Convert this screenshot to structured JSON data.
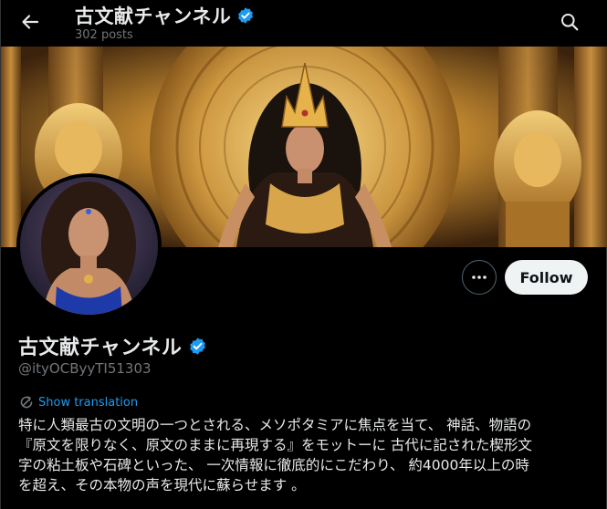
{
  "header": {
    "title": "古文献チャンネル",
    "posts": "302 posts",
    "back_icon": "arrow-left-icon",
    "search_icon": "search-icon"
  },
  "profile": {
    "display_name": "古文献チャンネル",
    "handle": "@ityOCByyTI51303",
    "verified": true,
    "verified_color": "#1d9bf0",
    "show_translation": "Show translation",
    "bio_lines": [
      "特に人類最古の文明の一つとされる、メソポタミアに焦点を当て、 神話、物語の",
      "『原文を限りなく、原文のままに再現する』をモットーに 古代に記された楔形文",
      "字の粘土板や石碑といった、 一次情報に徹底的にこだわり、 約4000年以上の時",
      "を超え、その本物の声を現代に蘇らせます 。"
    ]
  },
  "actions": {
    "follow_label": "Follow",
    "more_icon": "more-dots-icon"
  },
  "colors": {
    "accent": "#1d9bf0",
    "background": "#000000",
    "text_primary": "#e7e9ea",
    "text_secondary": "#71767b"
  }
}
